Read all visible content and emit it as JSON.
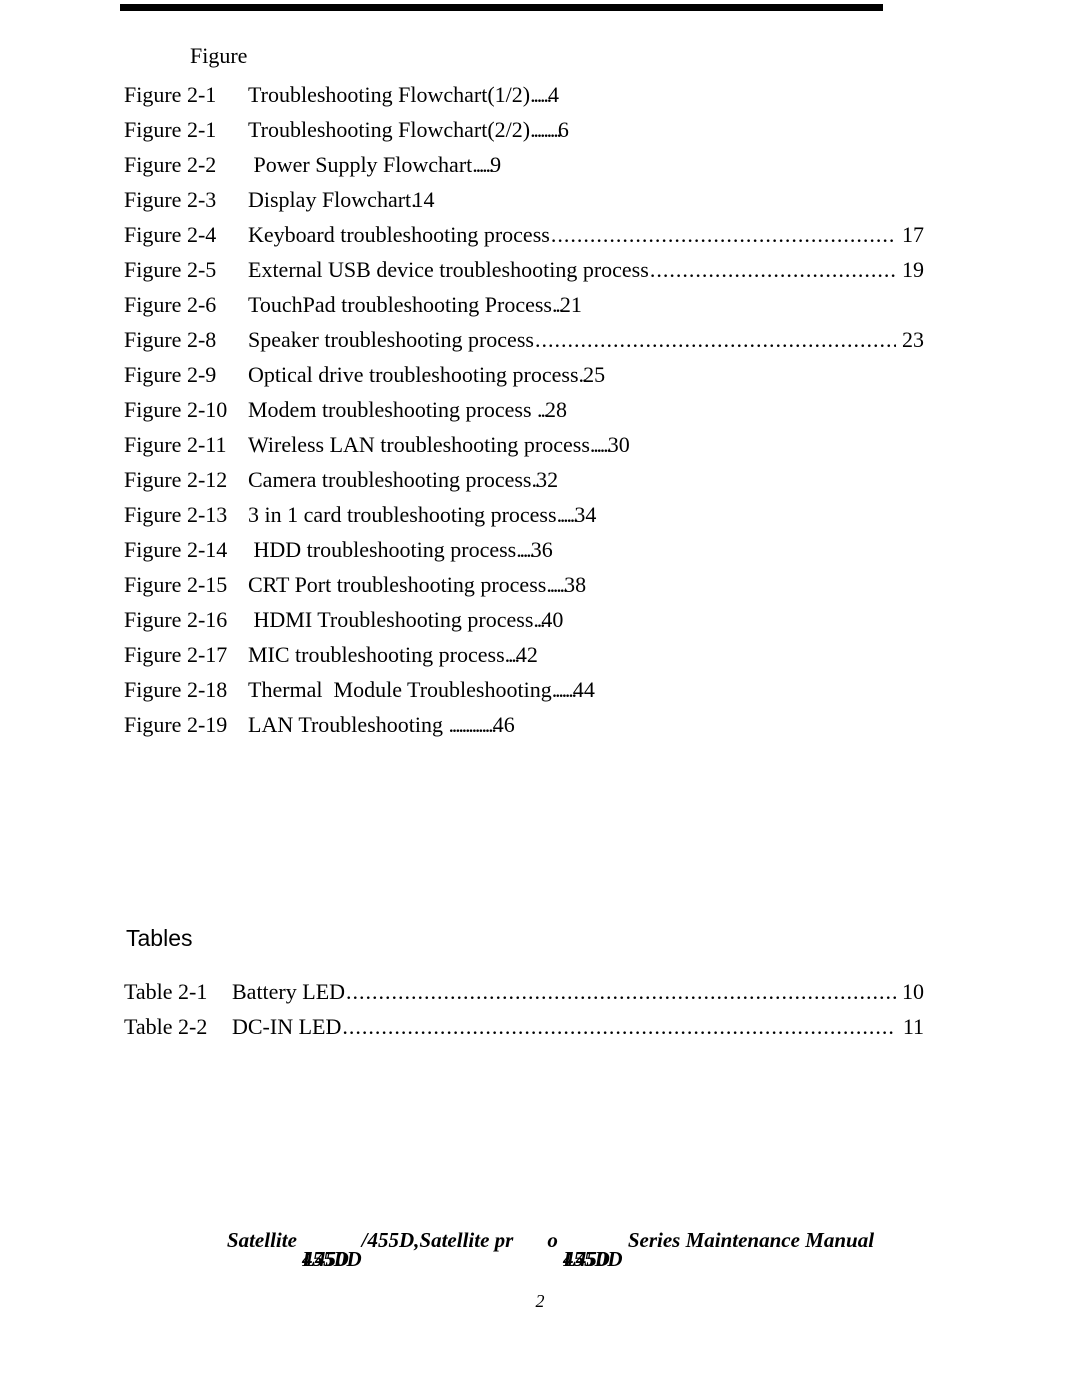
{
  "document": {
    "page_number": "2",
    "footer": {
      "prefix": "Satellite ",
      "model_overlap_1": [
        "L450D",
        "455D"
      ],
      "middle": "/455D,Satellite pr",
      "gap_then": "o ",
      "model_overlap_2": [
        "L450D",
        "455D"
      ],
      "suffix": " Series Maintenance Manual"
    }
  },
  "figures": {
    "heading": "Figure",
    "entries": [
      {
        "label": "Figure 2-1",
        "title": "Troubleshooting Flowchart(1/2)",
        "leader": "......",
        "page": "4",
        "style": "short"
      },
      {
        "label": "Figure 2-1",
        "title": "Troubleshooting Flowchart(2/2)",
        "leader": ".........",
        "page": "6",
        "style": "short"
      },
      {
        "label": "Figure 2-2",
        "title": " Power Supply Flowchart",
        "leader": "......",
        "page": "9",
        "style": "short"
      },
      {
        "label": "Figure 2-3",
        "title": "Display Flowchart",
        "leader": ".",
        "page": "14",
        "style": "short"
      },
      {
        "label": "Figure 2-4",
        "title": "Keyboard troubleshooting process",
        "leader": "",
        "page": "17",
        "style": "full"
      },
      {
        "label": "Figure 2-5",
        "title": "External USB device troubleshooting process",
        "leader": "",
        "page": "19",
        "style": "full"
      },
      {
        "label": "Figure 2-6",
        "title": "TouchPad troubleshooting Process",
        "leader": "...",
        "page": "21",
        "style": "short"
      },
      {
        "label": "Figure 2-8",
        "title": "Speaker troubleshooting process",
        "leader": "",
        "page": "23",
        "style": "full"
      },
      {
        "label": "Figure 2-9",
        "title": "Optical drive troubleshooting process",
        "leader": "..",
        "page": "25",
        "style": "short"
      },
      {
        "label": "Figure 2-10",
        "title": "Modem troubleshooting process ",
        "leader": "...",
        "page": "28",
        "style": "short"
      },
      {
        "label": "Figure 2-11",
        "title": "Wireless LAN troubleshooting process",
        "leader": "......",
        "page": "30",
        "style": "short"
      },
      {
        "label": "Figure 2-12",
        "title": "Camera troubleshooting process",
        "leader": "..",
        "page": "32",
        "style": "short"
      },
      {
        "label": "Figure 2-13",
        "title": "3 in 1 card troubleshooting process",
        "leader": "......",
        "page": "34",
        "style": "short"
      },
      {
        "label": "Figure 2-14",
        "title": " HDD troubleshooting process",
        "leader": ".....",
        "page": "36",
        "style": "short"
      },
      {
        "label": "Figure 2-15",
        "title": "CRT Port troubleshooting process",
        "leader": "......",
        "page": "38",
        "style": "short"
      },
      {
        "label": "Figure 2-16",
        "title": " HDMI Troubleshooting process",
        "leader": "...",
        "page": "40",
        "style": "short"
      },
      {
        "label": "Figure 2-17",
        "title": "MIC troubleshooting process",
        "leader": "....",
        "page": "42",
        "style": "short"
      },
      {
        "label": "Figure 2-18",
        "title": "Thermal  Module Troubleshooting",
        "leader": ".......",
        "page": "44",
        "style": "short"
      },
      {
        "label": "Figure 2-19",
        "title": "LAN Troubleshooting ",
        "leader": "..............",
        "page": "46",
        "style": "short"
      }
    ]
  },
  "tables": {
    "heading": "Tables",
    "entries": [
      {
        "label": "Table 2-1",
        "title": "Battery LED",
        "leader": "",
        "page": "10",
        "style": "full"
      },
      {
        "label": "Table 2-2",
        "title": "DC-IN LED",
        "leader": "",
        "page": "11",
        "style": "full"
      }
    ]
  }
}
